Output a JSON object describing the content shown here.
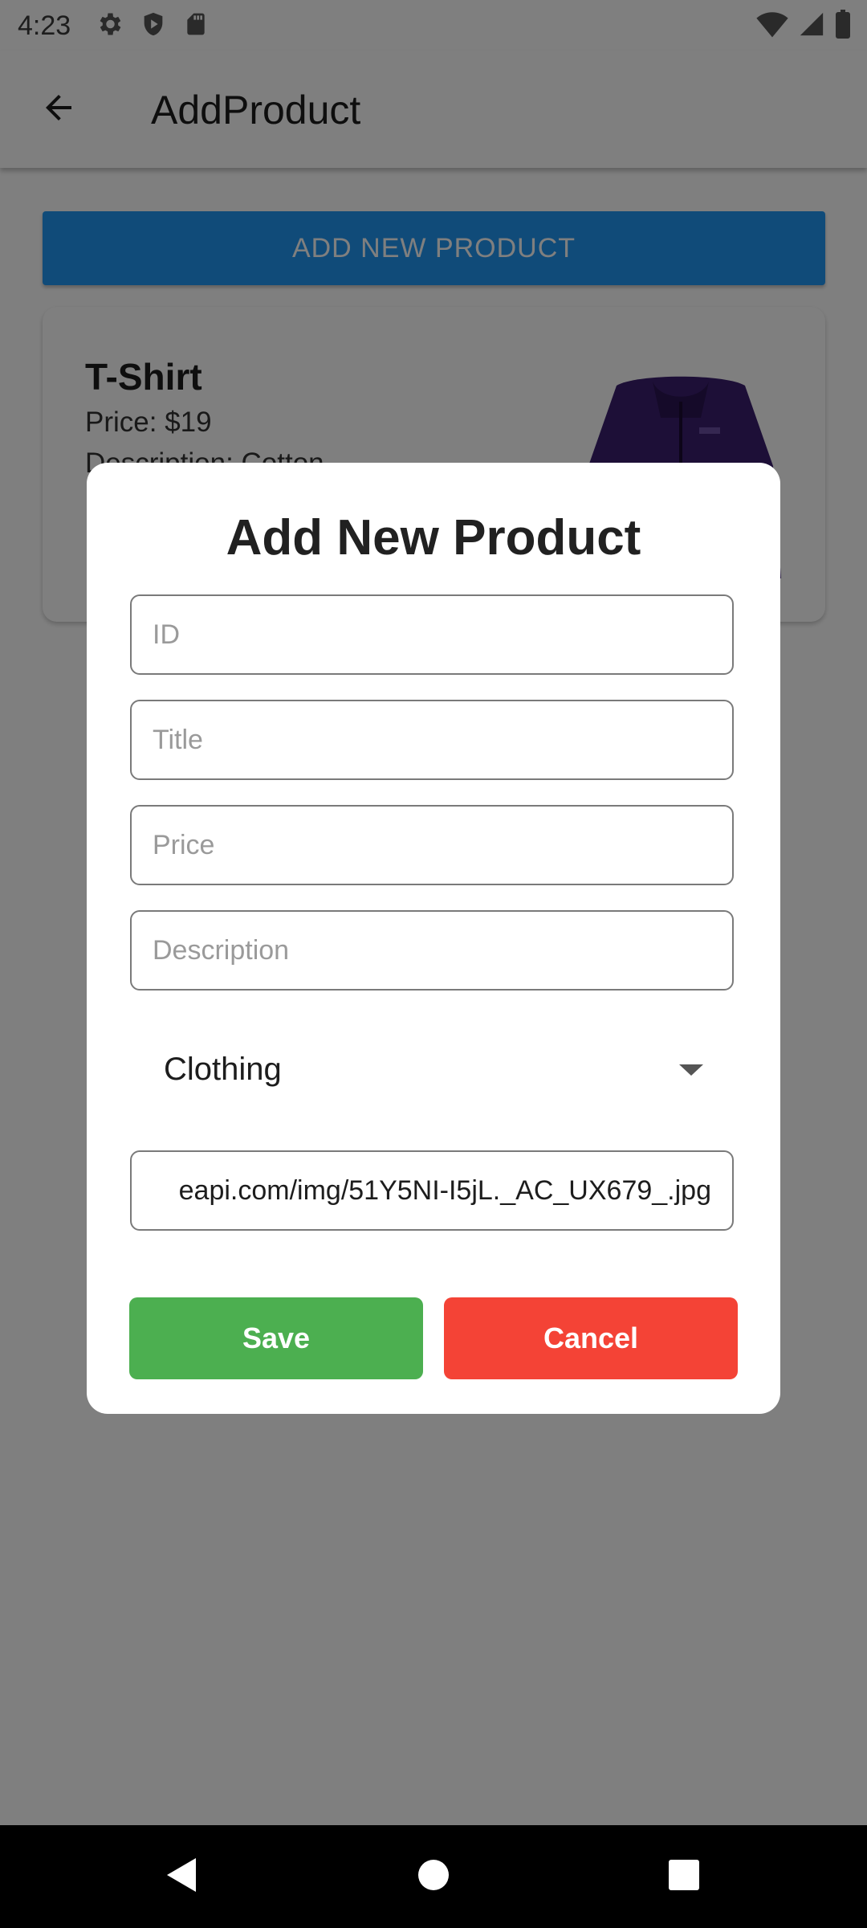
{
  "status_bar": {
    "time": "4:23",
    "left_icons": [
      "settings-icon",
      "shield-icon",
      "sd-card-icon"
    ],
    "right_icons": [
      "wifi-icon",
      "signal-icon",
      "battery-icon"
    ]
  },
  "app_bar": {
    "title": "AddProduct",
    "back_icon": "arrow-back-icon"
  },
  "main": {
    "add_button_label": "ADD NEW PRODUCT",
    "product_card": {
      "title": "T-Shirt",
      "price": "Price: $19",
      "description": "Description: Cotton"
    }
  },
  "dialog": {
    "title": "Add New Product",
    "fields": {
      "id_placeholder": "ID",
      "title_placeholder": "Title",
      "price_placeholder": "Price",
      "description_placeholder": "Description",
      "image_url_value": "eapi.com/img/51Y5NI-I5jL._AC_UX679_.jpg"
    },
    "category": {
      "selected": "Clothing"
    },
    "save_label": "Save",
    "cancel_label": "Cancel"
  },
  "nav_bar": {
    "icons": [
      "nav-back-icon",
      "nav-home-icon",
      "nav-recents-icon"
    ]
  },
  "colors": {
    "primary": "#2196f3",
    "save": "#4caf50",
    "cancel": "#f44336",
    "scrim": "rgba(0,0,0,0.5)"
  }
}
